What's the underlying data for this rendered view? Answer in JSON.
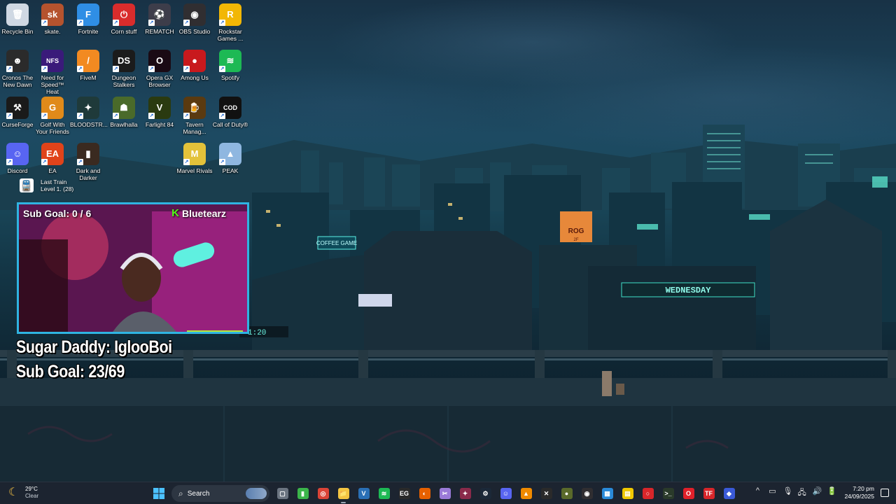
{
  "desktop": {
    "icons": [
      {
        "label": "Recycle Bin",
        "glyph": "🗑",
        "bg": "#cfd8e3",
        "icon": "recycle-bin-icon"
      },
      {
        "label": "skate.",
        "glyph": "sk",
        "bg": "#b5532e",
        "icon": "skate-icon"
      },
      {
        "label": "Fortnite",
        "glyph": "F",
        "bg": "#2f8ee5",
        "icon": "fortnite-icon"
      },
      {
        "label": "Corn stuff",
        "glyph": "⏻",
        "bg": "#d92c2c",
        "icon": "power-icon"
      },
      {
        "label": "REMATCH",
        "glyph": "⚽",
        "bg": "#3d3d4a",
        "icon": "rematch-icon"
      },
      {
        "label": "OBS Studio",
        "glyph": "◉",
        "bg": "#302e31",
        "icon": "obs-icon"
      },
      {
        "label": "Rockstar Games ...",
        "glyph": "R",
        "bg": "#f2b705",
        "icon": "rockstar-icon"
      },
      {
        "label": "Cronos The New Dawn",
        "glyph": "☻",
        "bg": "#2b2b2b",
        "icon": "cronos-icon"
      },
      {
        "label": "Need for Speed™ Heat",
        "glyph": "NFS",
        "bg": "#3a1a7a",
        "icon": "nfs-icon"
      },
      {
        "label": "FiveM",
        "glyph": "/",
        "bg": "#f28a21",
        "icon": "fivem-icon"
      },
      {
        "label": "Dungeon Stalkers",
        "glyph": "DS",
        "bg": "#1b1b1b",
        "icon": "dungeon-stalkers-icon"
      },
      {
        "label": "Opera GX Browser",
        "glyph": "O",
        "bg": "#1a0a14",
        "icon": "opera-gx-icon"
      },
      {
        "label": "Among Us",
        "glyph": "●",
        "bg": "#c8191d",
        "icon": "among-us-icon"
      },
      {
        "label": "Spotify",
        "glyph": "≋",
        "bg": "#1db954",
        "icon": "spotify-icon"
      },
      {
        "label": "CurseForge",
        "glyph": "⚒",
        "bg": "#1a1a1a",
        "icon": "curseforge-icon"
      },
      {
        "label": "Golf With Your Friends",
        "glyph": "G",
        "bg": "#e08a1a",
        "icon": "golf-icon"
      },
      {
        "label": "BLOODSTR...",
        "glyph": "✦",
        "bg": "#1f3a3a",
        "icon": "bloodstrike-icon"
      },
      {
        "label": "Brawlhalla",
        "glyph": "☗",
        "bg": "#4a6a2a",
        "icon": "brawlhalla-icon"
      },
      {
        "label": "Farlight 84",
        "glyph": "V",
        "bg": "#2a3a10",
        "icon": "farlight-icon"
      },
      {
        "label": "Tavern Manag...",
        "glyph": "🍺",
        "bg": "#5a3a10",
        "icon": "tavern-icon"
      },
      {
        "label": "Call of Duty®",
        "glyph": "COD",
        "bg": "#111111",
        "icon": "call-of-duty-icon"
      },
      {
        "label": "Discord",
        "glyph": "☺",
        "bg": "#5865f2",
        "icon": "discord-icon"
      },
      {
        "label": "EA",
        "glyph": "EA",
        "bg": "#e0431a",
        "icon": "ea-icon"
      },
      {
        "label": "Dark and Darker",
        "glyph": "▮",
        "bg": "#3a2a20",
        "icon": "dark-and-darker-icon"
      },
      {
        "label": "Marvel Rivals",
        "glyph": "M",
        "bg": "#e3c23a",
        "icon": "marvel-rivals-icon"
      },
      {
        "label": "PEAK",
        "glyph": "▲",
        "bg": "#8fb7e0",
        "icon": "peak-icon"
      }
    ],
    "last_train": {
      "label": "Last Train",
      "sublabel": "Level 1. (28)",
      "glyph": "🚆"
    }
  },
  "overlay": {
    "cam_goal": "Sub Goal: 0 / 6",
    "channel": "Bluetearz",
    "kick_glyph": "K",
    "line1": "Sugar Daddy: IglooBoi",
    "line2": "Sub Goal: 23/69"
  },
  "wallpaper": {
    "sign1": "WEDNESDAY",
    "sign2": "COFFEE GAME",
    "sign3": "ROG",
    "sign4": "2F",
    "clock": "1:20"
  },
  "taskbar": {
    "weather_temp": "29°C",
    "weather_desc": "Clear",
    "search_label": "Search",
    "apps": [
      {
        "name": "task-view",
        "glyph": "▢",
        "bg": "#6b7480"
      },
      {
        "name": "app-green",
        "glyph": "▮",
        "bg": "#3bb54a"
      },
      {
        "name": "chrome",
        "glyph": "◎",
        "bg": "#db4437"
      },
      {
        "name": "file-explorer",
        "glyph": "📁",
        "bg": "#f5c542",
        "active": true
      },
      {
        "name": "vs",
        "glyph": "V",
        "bg": "#2a6fb5"
      },
      {
        "name": "spotify",
        "glyph": "≋",
        "bg": "#1db954"
      },
      {
        "name": "epic",
        "glyph": "EG",
        "bg": "#2a2a2a"
      },
      {
        "name": "firefox",
        "glyph": "◐",
        "bg": "#e66000"
      },
      {
        "name": "snip",
        "glyph": "✂",
        "bg": "#9a7ad8"
      },
      {
        "name": "app-pink",
        "glyph": "✦",
        "bg": "#8a2a4a"
      },
      {
        "name": "steam",
        "glyph": "⚙",
        "bg": "#1b2838"
      },
      {
        "name": "discord",
        "glyph": "☺",
        "bg": "#5865f2"
      },
      {
        "name": "vlc",
        "glyph": "▲",
        "bg": "#f08a00"
      },
      {
        "name": "capcut",
        "glyph": "✕",
        "bg": "#2a2a2a"
      },
      {
        "name": "app-olive",
        "glyph": "●",
        "bg": "#5a6a2a"
      },
      {
        "name": "obs",
        "glyph": "◉",
        "bg": "#302e31"
      },
      {
        "name": "photos",
        "glyph": "▦",
        "bg": "#2a8ad8"
      },
      {
        "name": "sticky-notes",
        "glyph": "▤",
        "bg": "#f0c800"
      },
      {
        "name": "app-red",
        "glyph": "○",
        "bg": "#d8262a"
      },
      {
        "name": "terminal",
        "glyph": ">_",
        "bg": "#2a3a2a"
      },
      {
        "name": "opera-gx",
        "glyph": "O",
        "bg": "#e0202a"
      },
      {
        "name": "app-tf",
        "glyph": "TF",
        "bg": "#d8262a"
      },
      {
        "name": "app-blue",
        "glyph": "◆",
        "bg": "#3a5ad8"
      }
    ],
    "time": "7:20 pm",
    "date": "24/09/2025",
    "tray_glyphs": [
      "^",
      "▭",
      "🎙",
      "🖧",
      "🔊",
      "🔋"
    ]
  }
}
